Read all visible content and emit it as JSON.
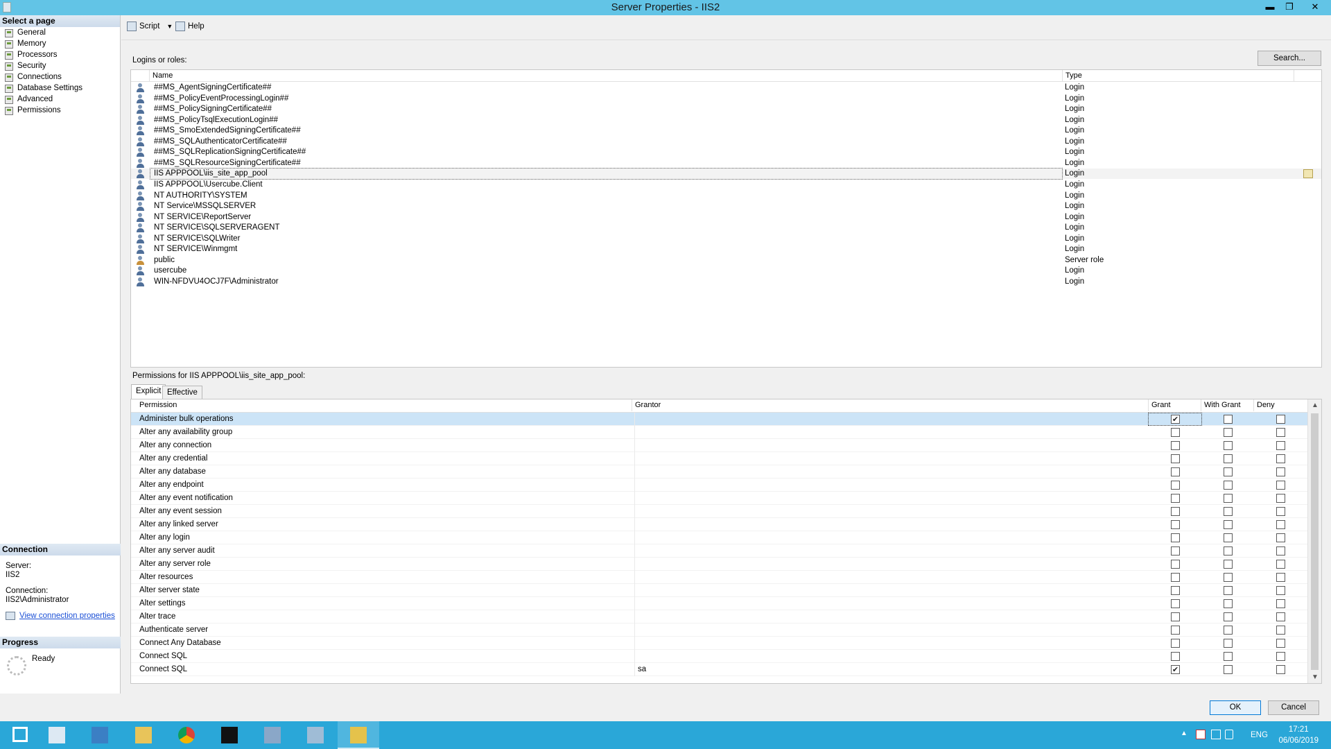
{
  "window": {
    "title": "Server Properties - IIS2",
    "minimize": "▬",
    "restore": "❐",
    "close": "✕"
  },
  "left_pane": {
    "select_page_label": "Select a page",
    "pages": [
      "General",
      "Memory",
      "Processors",
      "Security",
      "Connections",
      "Database Settings",
      "Advanced",
      "Permissions"
    ],
    "connection": {
      "header": "Connection",
      "server_label": "Server:",
      "server_value": "IIS2",
      "connection_label": "Connection:",
      "connection_value": "IIS2\\Administrator",
      "view_link": "View connection properties"
    },
    "progress": {
      "header": "Progress",
      "status": "Ready"
    }
  },
  "toolbar": {
    "script_label": "Script",
    "help_label": "Help"
  },
  "logins": {
    "label": "Logins or roles:",
    "search_button": "Search...",
    "columns": [
      "Name",
      "Type"
    ],
    "rows": [
      {
        "name": "##MS_AgentSigningCertificate##",
        "type": "Login"
      },
      {
        "name": "##MS_PolicyEventProcessingLogin##",
        "type": "Login"
      },
      {
        "name": "##MS_PolicySigningCertificate##",
        "type": "Login"
      },
      {
        "name": "##MS_PolicyTsqlExecutionLogin##",
        "type": "Login"
      },
      {
        "name": "##MS_SmoExtendedSigningCertificate##",
        "type": "Login"
      },
      {
        "name": "##MS_SQLAuthenticatorCertificate##",
        "type": "Login"
      },
      {
        "name": "##MS_SQLReplicationSigningCertificate##",
        "type": "Login"
      },
      {
        "name": "##MS_SQLResourceSigningCertificate##",
        "type": "Login"
      },
      {
        "name": "IIS APPPOOL\\iis_site_app_pool",
        "type": "Login"
      },
      {
        "name": "IIS APPPOOL\\Usercube.Client",
        "type": "Login"
      },
      {
        "name": "NT AUTHORITY\\SYSTEM",
        "type": "Login"
      },
      {
        "name": "NT Service\\MSSQLSERVER",
        "type": "Login"
      },
      {
        "name": "NT SERVICE\\ReportServer",
        "type": "Login"
      },
      {
        "name": "NT SERVICE\\SQLSERVERAGENT",
        "type": "Login"
      },
      {
        "name": "NT SERVICE\\SQLWriter",
        "type": "Login"
      },
      {
        "name": "NT SERVICE\\Winmgmt",
        "type": "Login"
      },
      {
        "name": "public",
        "type": "Server role"
      },
      {
        "name": "usercube",
        "type": "Login"
      },
      {
        "name": "WIN-NFDVU4OCJ7F\\Administrator",
        "type": "Login"
      }
    ],
    "selected_index": 8
  },
  "permissions": {
    "label": "Permissions for IIS APPPOOL\\iis_site_app_pool:",
    "tabs": [
      "Explicit",
      "Effective"
    ],
    "active_tab": "Explicit",
    "columns": [
      "Permission",
      "Grantor",
      "Grant",
      "With Grant",
      "Deny"
    ],
    "rows": [
      {
        "permission": "Administer bulk operations",
        "grantor": "",
        "grant": true,
        "with_grant": false,
        "deny": false
      },
      {
        "permission": "Alter any availability group",
        "grantor": "",
        "grant": false,
        "with_grant": false,
        "deny": false
      },
      {
        "permission": "Alter any connection",
        "grantor": "",
        "grant": false,
        "with_grant": false,
        "deny": false
      },
      {
        "permission": "Alter any credential",
        "grantor": "",
        "grant": false,
        "with_grant": false,
        "deny": false
      },
      {
        "permission": "Alter any database",
        "grantor": "",
        "grant": false,
        "with_grant": false,
        "deny": false
      },
      {
        "permission": "Alter any endpoint",
        "grantor": "",
        "grant": false,
        "with_grant": false,
        "deny": false
      },
      {
        "permission": "Alter any event notification",
        "grantor": "",
        "grant": false,
        "with_grant": false,
        "deny": false
      },
      {
        "permission": "Alter any event session",
        "grantor": "",
        "grant": false,
        "with_grant": false,
        "deny": false
      },
      {
        "permission": "Alter any linked server",
        "grantor": "",
        "grant": false,
        "with_grant": false,
        "deny": false
      },
      {
        "permission": "Alter any login",
        "grantor": "",
        "grant": false,
        "with_grant": false,
        "deny": false
      },
      {
        "permission": "Alter any server audit",
        "grantor": "",
        "grant": false,
        "with_grant": false,
        "deny": false
      },
      {
        "permission": "Alter any server role",
        "grantor": "",
        "grant": false,
        "with_grant": false,
        "deny": false
      },
      {
        "permission": "Alter resources",
        "grantor": "",
        "grant": false,
        "with_grant": false,
        "deny": false
      },
      {
        "permission": "Alter server state",
        "grantor": "",
        "grant": false,
        "with_grant": false,
        "deny": false
      },
      {
        "permission": "Alter settings",
        "grantor": "",
        "grant": false,
        "with_grant": false,
        "deny": false
      },
      {
        "permission": "Alter trace",
        "grantor": "",
        "grant": false,
        "with_grant": false,
        "deny": false
      },
      {
        "permission": "Authenticate server",
        "grantor": "",
        "grant": false,
        "with_grant": false,
        "deny": false
      },
      {
        "permission": "Connect Any Database",
        "grantor": "",
        "grant": false,
        "with_grant": false,
        "deny": false
      },
      {
        "permission": "Connect SQL",
        "grantor": "",
        "grant": false,
        "with_grant": false,
        "deny": false
      },
      {
        "permission": "Connect SQL",
        "grantor": "sa",
        "grant": true,
        "with_grant": false,
        "deny": false
      }
    ],
    "selected_index": 0
  },
  "buttons": {
    "ok": "OK",
    "cancel": "Cancel"
  },
  "taskbar": {
    "apps": [
      "start-icon",
      "server-manager-icon",
      "powershell-icon",
      "file-explorer-icon",
      "chrome-icon",
      "cmd-icon",
      "sql-config-icon",
      "notepad-icon",
      "ssms-icon"
    ],
    "language": "ENG",
    "time": "17:21",
    "date": "06/06/2019"
  },
  "colors": {
    "titlebar": "#62c4e6",
    "taskbar": "#2aa7d8",
    "selection": "#cce4f7",
    "link": "#1a4fd6"
  }
}
